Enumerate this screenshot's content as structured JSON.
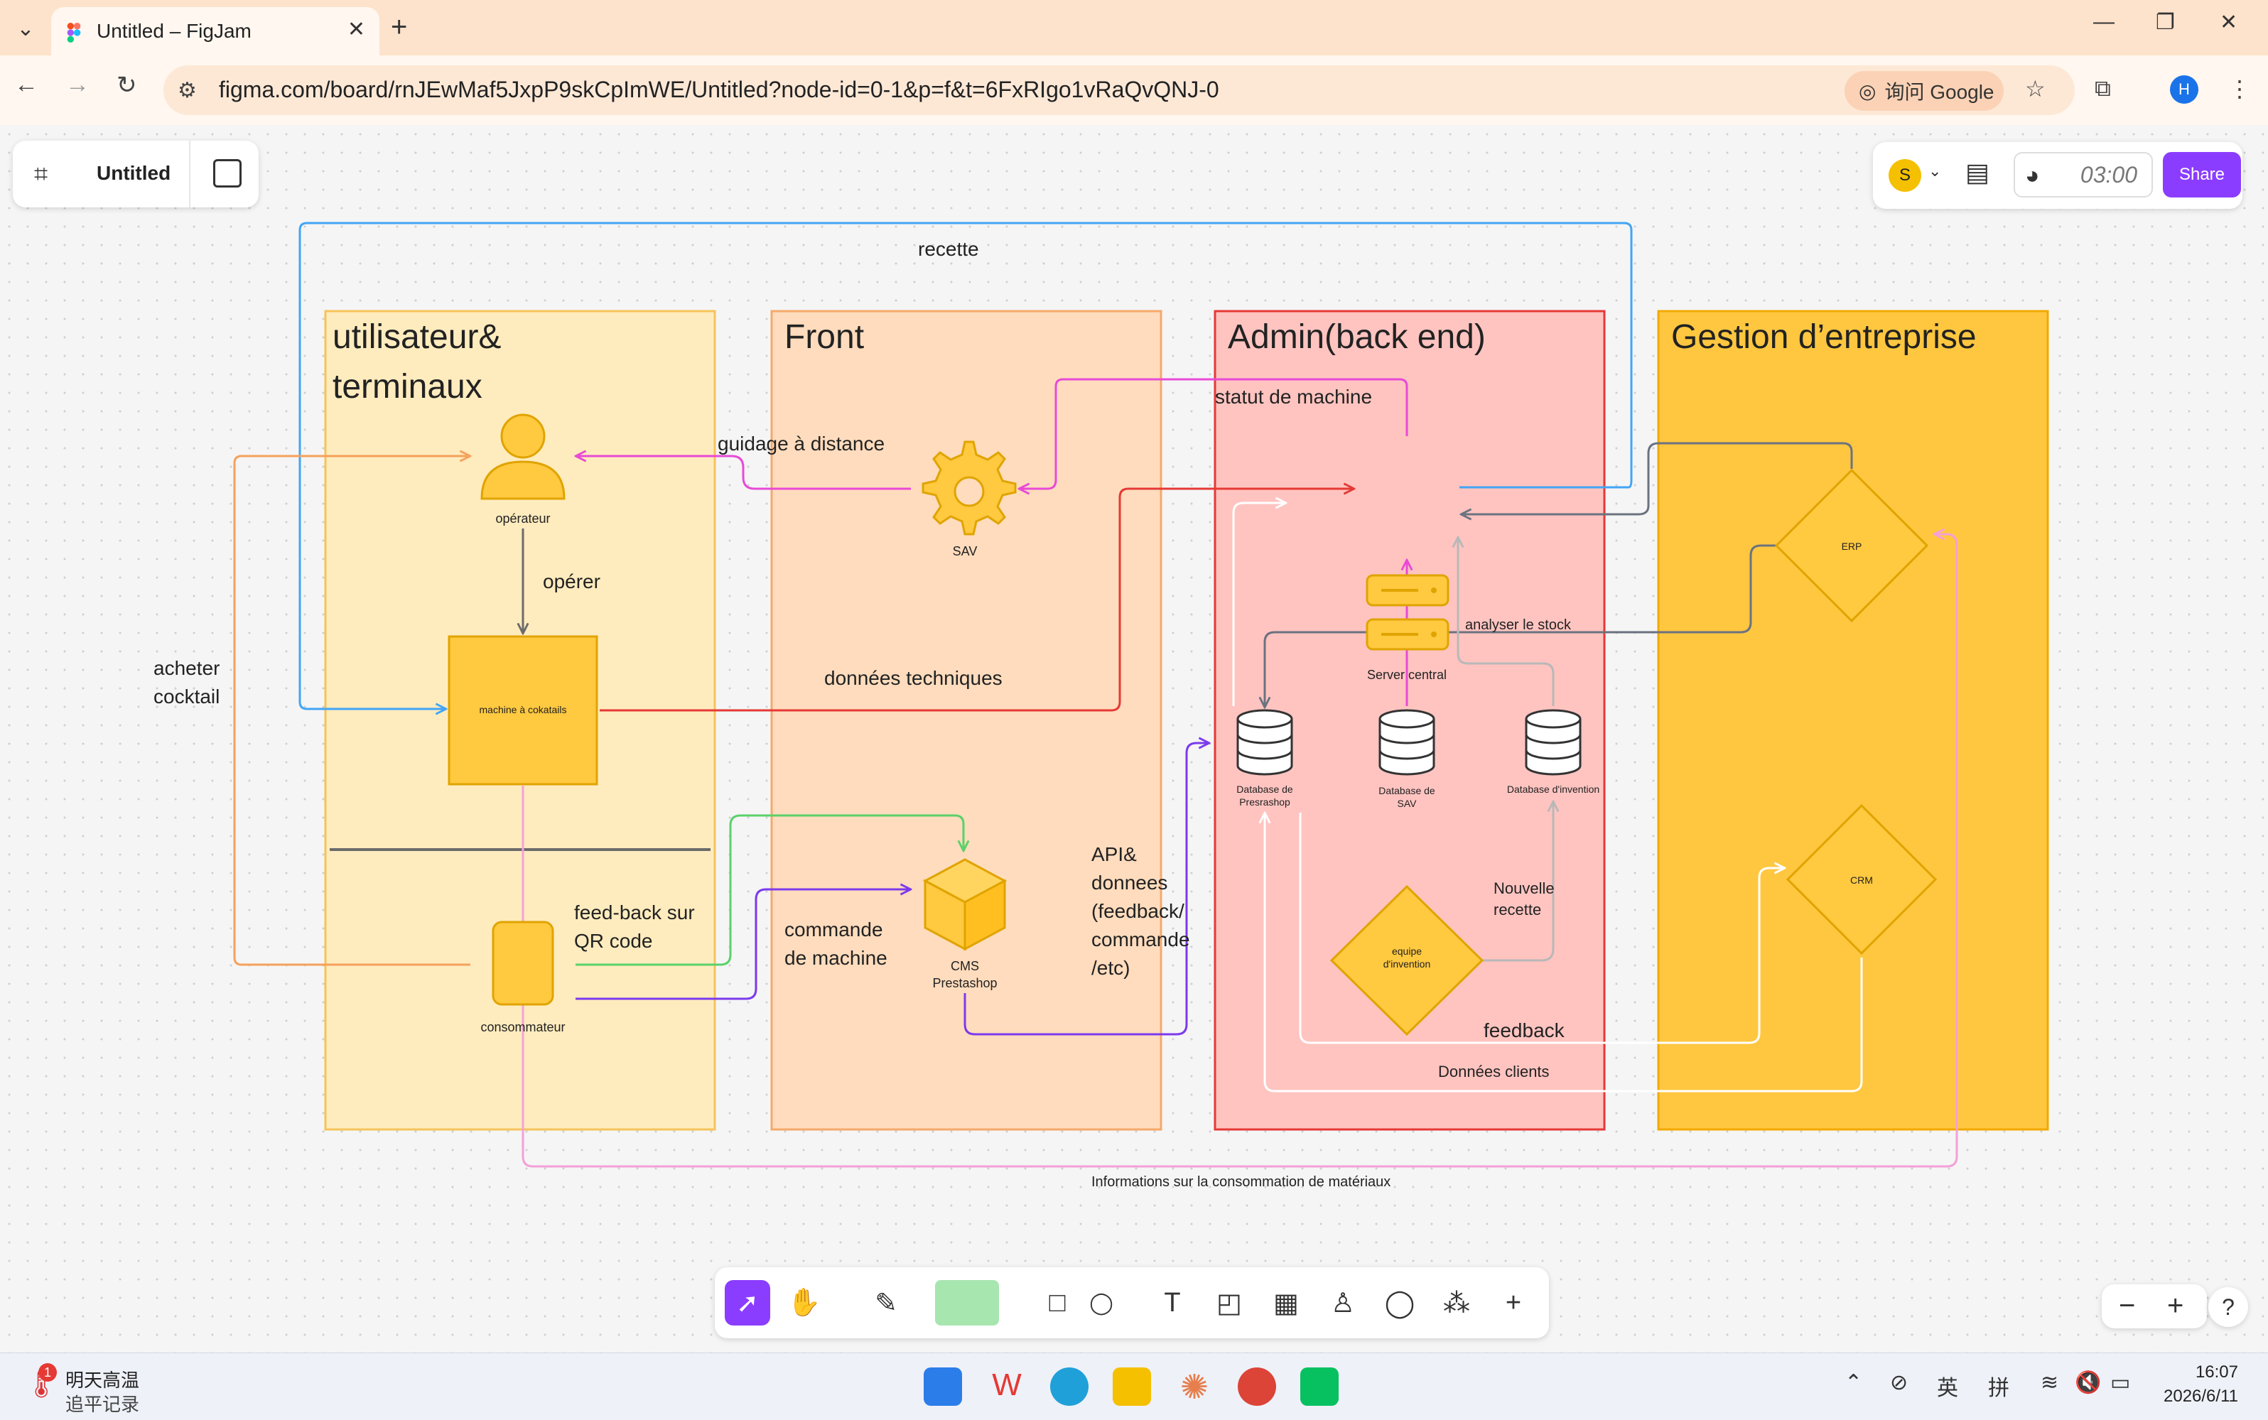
{
  "browser": {
    "tab_title": "Untitled – FigJam",
    "url": "figma.com/board/rnJEwMaf5JxpP9skCpImWE/Untitled?node-id=0-1&p=f&t=6FxRIgo1vRaQvQNJ-0",
    "google_chip": "询问 Google",
    "profile_initial": "H"
  },
  "figjam": {
    "file_name": "Untitled",
    "avatar_initial": "S",
    "timer": "03:00",
    "share_label": "Share"
  },
  "diagram": {
    "title_recette": "recette",
    "columns": [
      {
        "title": "utilisateur&",
        "title2": "terminaux",
        "color": "#ffecbe",
        "border": "#f6c35a"
      },
      {
        "title": "Front",
        "color": "#ffdcbd",
        "border": "#f5a96a"
      },
      {
        "title": "Admin(back end)",
        "color": "#ffc4c0",
        "border": "#e53935"
      },
      {
        "title": "Gestion d’entreprise",
        "color": "#ffc740",
        "border": "#f2a900"
      }
    ],
    "nodes": {
      "operateur": "opérateur",
      "machine": "machine à cokatails",
      "consommateur": "consommateur",
      "sav": "SAV",
      "cms_line1": "CMS",
      "cms_line2": "Prestashop",
      "server": "Server central",
      "db_presta_1": "Database de",
      "db_presta_2": "Presrashop",
      "db_sav_1": "Database de",
      "db_sav_2": "SAV",
      "db_invention": "Database d'invention",
      "equipe_1": "equipe",
      "equipe_2": "d'invention",
      "erp": "ERP",
      "crm": "CRM"
    },
    "labels": {
      "guidage": "guidage à distance",
      "operer": "opérer",
      "acheter_1": "acheter",
      "acheter_2": "cocktail",
      "donnees_tech": "données techniques",
      "statut": "statut de machine",
      "feedback_qr_1": "feed-back sur",
      "feedback_qr_2": "QR code",
      "commande_1": "commande",
      "commande_2": "de machine",
      "api_1": "API&",
      "api_2": "donnees",
      "api_3": "(feedback/",
      "api_4": "commande",
      "api_5": "/etc)",
      "analyser": "analyser le stock",
      "nouvelle_1": "Nouvelle",
      "nouvelle_2": "recette",
      "feedback": "feedback",
      "donnees_clients": "Données clients",
      "informations": "Informations sur la consommation de matériaux"
    }
  },
  "taskbar": {
    "weather_line1": "明天高温",
    "weather_line2": "追平记录",
    "weather_badge": "1",
    "ime_1": "英",
    "ime_2": "拼",
    "time": "16:07",
    "date": "2026/6/11"
  },
  "colors": {
    "accent": "#8b3dff",
    "blue_arrow": "#42a5f5",
    "orange_arrow": "#f5a15c",
    "pink_arrow": "#e84ad6",
    "red_arrow": "#e53935",
    "green_arrow": "#5ad16a",
    "purple_arrow": "#7c3aed",
    "grey_arrow": "#6b7280",
    "icon_yellow": "#ffc940"
  }
}
